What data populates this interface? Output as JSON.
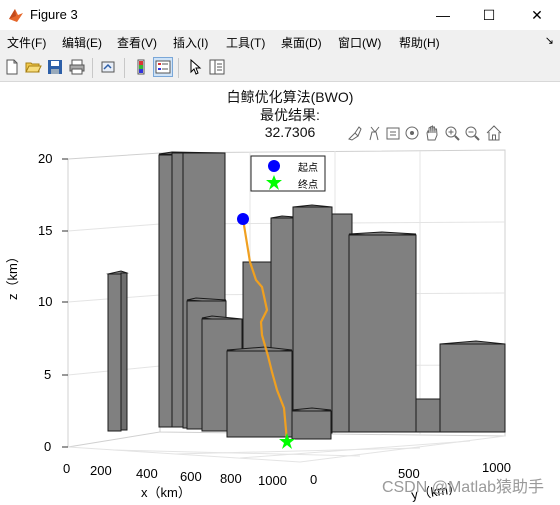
{
  "window": {
    "title": "Figure 3",
    "minimize": "—",
    "maximize": "☐",
    "close": "✕"
  },
  "menubar": {
    "items": [
      "文件(F)",
      "编辑(E)",
      "查看(V)",
      "插入(I)",
      "工具(T)",
      "桌面(D)",
      "窗口(W)",
      "帮助(H)"
    ],
    "overflow": "↘"
  },
  "toolbar": {
    "icons": [
      "new-figure-icon",
      "open-file-icon",
      "save-icon",
      "print-icon",
      "link-plot-icon",
      "insert-colorbar-icon",
      "insert-legend-icon",
      "edit-plot-icon",
      "property-inspector-icon"
    ]
  },
  "axes_toolbar": {
    "icons": [
      "brush-icon",
      "data-tips-icon",
      "save-axes-icon",
      "rotate-3d-icon",
      "pan-icon",
      "zoom-in-icon",
      "zoom-out-icon",
      "home-icon"
    ]
  },
  "plot": {
    "title_line1": "白鲸优化算法(BWO)",
    "title_line2": "最优结果:",
    "title_line3": "32.7306",
    "zlabel": "z（km）",
    "xlabel": "x（km）",
    "ylabel": "y（km）",
    "z_ticks": [
      "0",
      "5",
      "10",
      "15",
      "20"
    ],
    "x_ticks": [
      "0",
      "200",
      "400",
      "600",
      "800",
      "1000"
    ],
    "y_ticks": [
      "0",
      "500",
      "1000"
    ],
    "legend": {
      "start": "起点",
      "end": "终点",
      "start_color": "#0000ff",
      "end_color": "#00ff00"
    },
    "path_color": "#f0a020",
    "building_color": "#808080"
  },
  "watermark": "CSDN @Matlab猿助手"
}
